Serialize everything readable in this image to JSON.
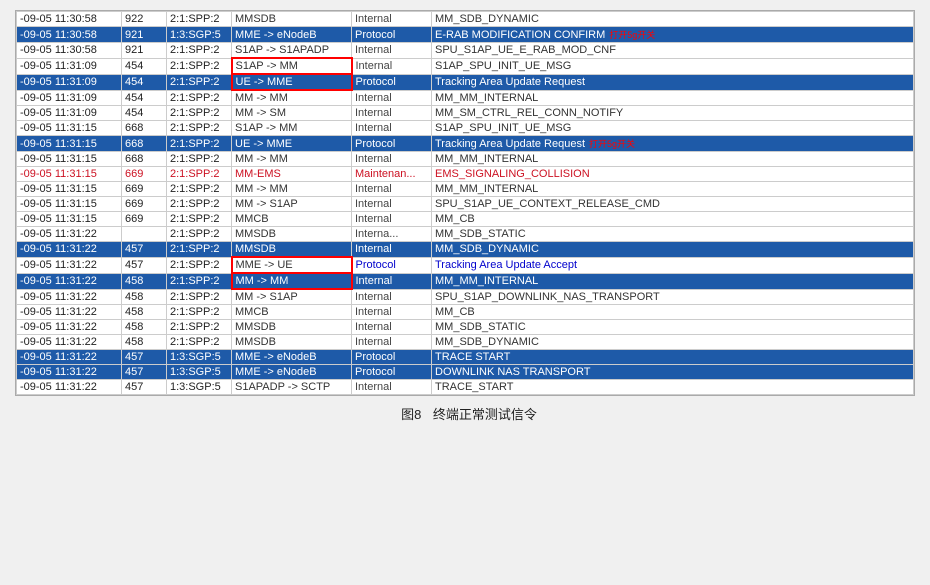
{
  "caption": {
    "figure": "图8",
    "text": "终端正常测试信令"
  },
  "rows": [
    {
      "time": "-09-05 11:30:58",
      "id": "922",
      "node": "2:1:SPP:2",
      "src_dest": "MMSDB",
      "type": "Internal",
      "message": "MM_SDB_DYNAMIC",
      "style": "white"
    },
    {
      "time": "-09-05 11:30:58",
      "id": "921",
      "node": "1:3:SGP:5",
      "src_dest": "MME -> eNodeB",
      "type": "Protocol",
      "message": "E-RAB MODIFICATION CONFIRM",
      "style": "blue",
      "annotation": "打开5g开关"
    },
    {
      "time": "-09-05 11:30:58",
      "id": "921",
      "node": "2:1:SPP:2",
      "src_dest": "S1AP -> S1APADP",
      "type": "Internal",
      "message": "SPU_S1AP_UE_E_RAB_MOD_CNF",
      "style": "white"
    },
    {
      "time": "-09-05 11:31:09",
      "id": "454",
      "node": "2:1:SPP:2",
      "src_dest": "S1AP -> MM",
      "type": "Internal",
      "message": "S1AP_SPU_INIT_UE_MSG",
      "style": "white",
      "box": true
    },
    {
      "time": "-09-05 11:31:09",
      "id": "454",
      "node": "2:1:SPP:2",
      "src_dest": "UE -> MME",
      "type": "Protocol",
      "message": "Tracking Area Update Request",
      "style": "blue",
      "box": true
    },
    {
      "time": "-09-05 11:31:09",
      "id": "454",
      "node": "2:1:SPP:2",
      "src_dest": "MM -> MM",
      "type": "Internal",
      "message": "MM_MM_INTERNAL",
      "style": "white"
    },
    {
      "time": "-09-05 11:31:09",
      "id": "454",
      "node": "2:1:SPP:2",
      "src_dest": "MM -> SM",
      "type": "Internal",
      "message": "MM_SM_CTRL_REL_CONN_NOTIFY",
      "style": "white"
    },
    {
      "time": "-09-05 11:31:15",
      "id": "668",
      "node": "2:1:SPP:2",
      "src_dest": "S1AP -> MM",
      "type": "Internal",
      "message": "S1AP_SPU_INIT_UE_MSG",
      "style": "white"
    },
    {
      "time": "-09-05 11:31:15",
      "id": "668",
      "node": "2:1:SPP:2",
      "src_dest": "UE -> MME",
      "type": "Protocol",
      "message": "Tracking Area Update Request",
      "style": "blue",
      "annotation2": "打开5g开关"
    },
    {
      "time": "-09-05 11:31:15",
      "id": "668",
      "node": "2:1:SPP:2",
      "src_dest": "MM -> MM",
      "type": "Internal",
      "message": "MM_MM_INTERNAL",
      "style": "white"
    },
    {
      "time": "-09-05 11:31:15",
      "id": "669",
      "node": "2:1:SPP:2",
      "src_dest": "MM-EMS",
      "type": "Maintenan...",
      "message": "EMS_SIGNALING_COLLISION",
      "style": "pink"
    },
    {
      "time": "-09-05 11:31:15",
      "id": "669",
      "node": "2:1:SPP:2",
      "src_dest": "MM -> MM",
      "type": "Internal",
      "message": "MM_MM_INTERNAL",
      "style": "white"
    },
    {
      "time": "-09-05 11:31:15",
      "id": "669",
      "node": "2:1:SPP:2",
      "src_dest": "MM -> S1AP",
      "type": "Internal",
      "message": "SPU_S1AP_UE_CONTEXT_RELEASE_CMD",
      "style": "white"
    },
    {
      "time": "-09-05 11:31:15",
      "id": "669",
      "node": "2:1:SPP:2",
      "src_dest": "MMCB",
      "type": "Internal",
      "message": "MM_CB",
      "style": "white"
    },
    {
      "time": "-09-05 11:31:22",
      "id": "",
      "node": "2:1:SPP:2",
      "src_dest": "MMSDB",
      "type": "Interna...",
      "message": "MM_SDB_STATIC",
      "style": "white"
    },
    {
      "time": "-09-05 11:31:22",
      "id": "457",
      "node": "2:1:SPP:2",
      "src_dest": "MMSDB",
      "type": "Internal",
      "message": "MM_SDB_DYNAMIC",
      "style": "blue"
    },
    {
      "time": "-09-05 11:31:22",
      "id": "457",
      "node": "2:1:SPP:2",
      "src_dest": "MME -> UE",
      "type": "Protocol",
      "message": "Tracking Area Update Accept",
      "style": "white",
      "box2": true
    },
    {
      "time": "-09-05 11:31:22",
      "id": "458",
      "node": "2:1:SPP:2",
      "src_dest": "MM -> MM",
      "type": "Internal",
      "message": "MM_MM_INTERNAL",
      "style": "blue",
      "box2": true
    },
    {
      "time": "-09-05 11:31:22",
      "id": "458",
      "node": "2:1:SPP:2",
      "src_dest": "MM -> S1AP",
      "type": "Internal",
      "message": "SPU_S1AP_DOWNLINK_NAS_TRANSPORT",
      "style": "white"
    },
    {
      "time": "-09-05 11:31:22",
      "id": "458",
      "node": "2:1:SPP:2",
      "src_dest": "MMCB",
      "type": "Internal",
      "message": "MM_CB",
      "style": "white"
    },
    {
      "time": "-09-05 11:31:22",
      "id": "458",
      "node": "2:1:SPP:2",
      "src_dest": "MMSDB",
      "type": "Internal",
      "message": "MM_SDB_STATIC",
      "style": "white"
    },
    {
      "time": "-09-05 11:31:22",
      "id": "458",
      "node": "2:1:SPP:2",
      "src_dest": "MMSDB",
      "type": "Internal",
      "message": "MM_SDB_DYNAMIC",
      "style": "white"
    },
    {
      "time": "-09-05 11:31:22",
      "id": "457",
      "node": "1:3:SGP:5",
      "src_dest": "MME -> eNodeB",
      "type": "Protocol",
      "message": "TRACE START",
      "style": "blue"
    },
    {
      "time": "-09-05 11:31:22",
      "id": "457",
      "node": "1:3:SGP:5",
      "src_dest": "MME -> eNodeB",
      "type": "Protocol",
      "message": "DOWNLINK NAS TRANSPORT",
      "style": "blue"
    },
    {
      "time": "-09-05 11:31:22",
      "id": "457",
      "node": "1:3:SGP:5",
      "src_dest": "S1APADP -> SCTP",
      "type": "Internal",
      "message": "TRACE_START",
      "style": "white"
    }
  ]
}
